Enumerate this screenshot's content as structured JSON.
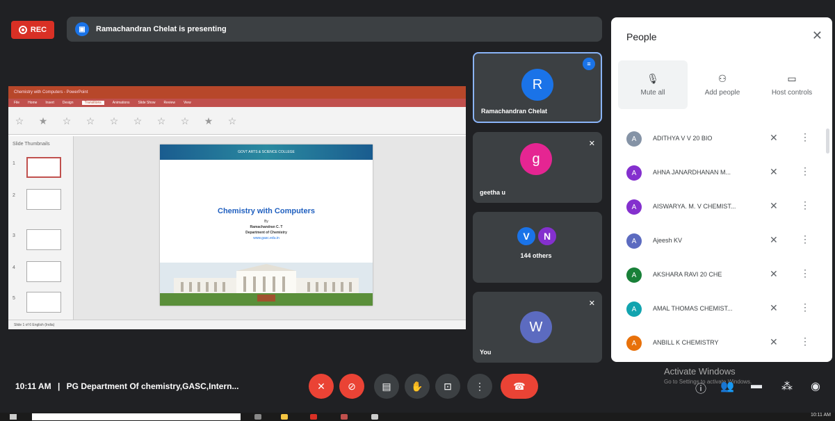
{
  "top": {
    "rec_label": "REC",
    "presenting_text": "Ramachandran Chelat is presenting"
  },
  "presentation": {
    "slide_header": "GOVT ARTS & SCIENCE COLLEGE",
    "slide_title": "Chemistry with Computers",
    "slide_by": "By",
    "slide_author": "Ramachandran C. T",
    "slide_dept": "Department of Chemistry",
    "slide_link": "www.gasc.edu.in",
    "ppt_title": "Chemistry with Computers - PowerPoint",
    "ppt_tabs": [
      "File",
      "Home",
      "Insert",
      "Design",
      "Transitions",
      "Animations",
      "Slide Show",
      "Review",
      "View"
    ],
    "ppt_status": "Slide 1 of 6  English (India)",
    "thumb_label": "Slide Thumbnails"
  },
  "tiles": [
    {
      "name": "Ramachandran Chelat",
      "initial": "R",
      "color": "#1a73e8"
    },
    {
      "name": "geetha u",
      "initial": "g",
      "color": "#e52592"
    },
    {
      "name": "144 others",
      "initials": [
        "V",
        "N"
      ],
      "colors": [
        "#1a73e8",
        "#8430ce"
      ]
    },
    {
      "name": "You",
      "initial": "W",
      "color": "#5c6bc0"
    }
  ],
  "panel": {
    "title": "People",
    "actions": [
      {
        "label": "Mute all",
        "icon": "mic-off-icon"
      },
      {
        "label": "Add people",
        "icon": "person-add-icon"
      },
      {
        "label": "Host controls",
        "icon": "host-controls-icon"
      }
    ],
    "participants": [
      {
        "initial": "A",
        "name": "ADITHYA V V 20 BIO",
        "color": "#8593a6"
      },
      {
        "initial": "A",
        "name": "AHNA JANARDHANAN M...",
        "color": "#8430ce"
      },
      {
        "initial": "A",
        "name": "AISWARYA. M. V CHEMIST...",
        "color": "#8430ce"
      },
      {
        "initial": "A",
        "name": "Ajeesh KV",
        "color": "#5c6bc0"
      },
      {
        "initial": "A",
        "name": "AKSHARA RAVI 20 CHE",
        "color": "#188038"
      },
      {
        "initial": "A",
        "name": "AMAL THOMAS CHEMIST...",
        "color": "#12a4af"
      },
      {
        "initial": "A",
        "name": "ANBILL K CHEMISTRY",
        "color": "#e8710a"
      }
    ]
  },
  "bottom": {
    "time": "10:11 AM",
    "separator": "|",
    "meeting": "PG Department Of chemistry,GASC,Intern...",
    "activate_title": "Activate Windows",
    "activate_sub": "Go to Settings to activate Windows.",
    "clock": "10:11 AM"
  }
}
